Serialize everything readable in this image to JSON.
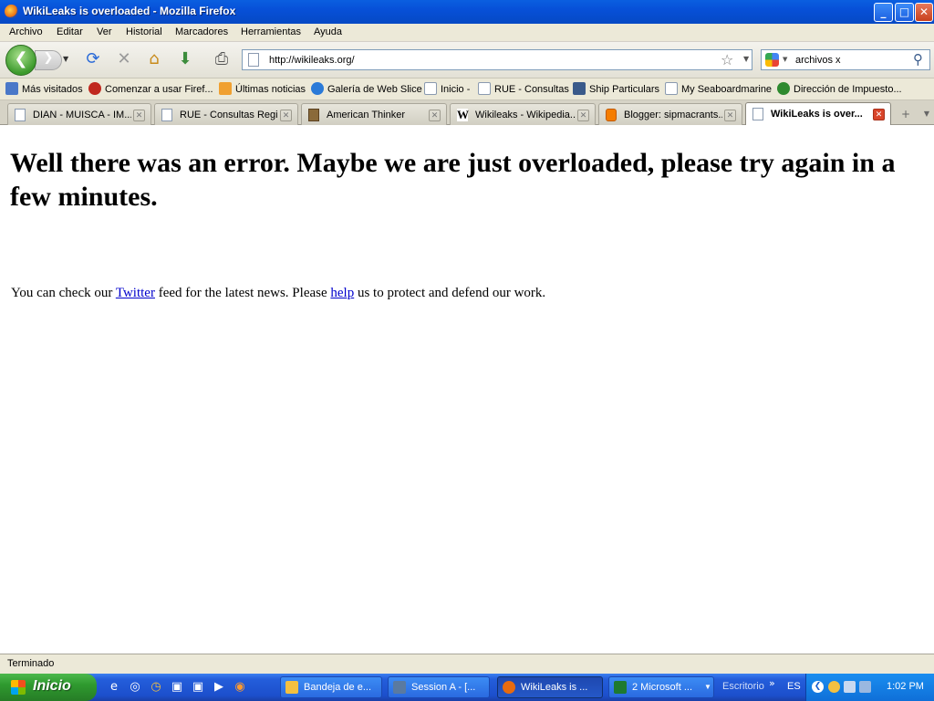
{
  "window": {
    "title": "WikiLeaks is overloaded - Mozilla Firefox",
    "controls": {
      "minimize": "_",
      "maximize": "□",
      "close": "✕"
    }
  },
  "menu": [
    "Archivo",
    "Editar",
    "Ver",
    "Historial",
    "Marcadores",
    "Herramientas",
    "Ayuda"
  ],
  "navigation": {
    "back_glyph": "❮",
    "forward_glyph": "❯",
    "url": "http://wikileaks.org/",
    "search_value": "archivos x",
    "icons": [
      "reload-icon",
      "stop-icon",
      "home-icon",
      "download-icon",
      "print-icon"
    ]
  },
  "bookmarks": [
    {
      "label": "Más visitados",
      "icon": "bookmark-folder-icon",
      "color": "#4a78c8"
    },
    {
      "label": "Comenzar a usar Firef...",
      "icon": "firefox-devil-icon",
      "color": "#c0281e"
    },
    {
      "label": "Últimas noticias",
      "icon": "rss-icon",
      "color": "#f0a030"
    },
    {
      "label": "Galería de Web Slice",
      "icon": "ie-icon",
      "color": "#2a7ad8"
    },
    {
      "label": "Inicio -",
      "icon": "page-icon",
      "color": "#ffffff"
    },
    {
      "label": "RUE - Consultas",
      "icon": "page-icon",
      "color": "#ffffff"
    },
    {
      "label": "Ship Particulars",
      "icon": "ship-icon",
      "color": "#3a5a8a"
    },
    {
      "label": "My Seaboardmarine",
      "icon": "page-icon",
      "color": "#ffffff"
    },
    {
      "label": "Dirección de Impuesto...",
      "icon": "dian-icon",
      "color": "#2e8a2e"
    }
  ],
  "tabs": [
    {
      "label": "DIAN - MUISCA - IM...",
      "active": false
    },
    {
      "label": "RUE - Consultas Regi...",
      "active": false
    },
    {
      "label": "American Thinker",
      "active": false
    },
    {
      "label": "Wikileaks - Wikipedia...",
      "active": false
    },
    {
      "label": "Blogger: sipmacrants...",
      "active": false
    },
    {
      "label": "WikiLeaks is over...",
      "active": true
    }
  ],
  "content": {
    "heading": "Well there was an error. Maybe we are just overloaded, please try again in a few minutes.",
    "p_before": "You can check our ",
    "link_twitter": "Twitter",
    "p_middle": " feed for the latest news. Please ",
    "link_help": "help",
    "p_after": " us to protect and defend our work."
  },
  "status": "Terminado",
  "taskbar": {
    "start": "Inicio",
    "buttons": [
      {
        "label": "Bandeja de e...",
        "color": "#f4c040"
      },
      {
        "label": "Session A - [...",
        "color": "#5a7aa0"
      },
      {
        "label": "WikiLeaks is ...",
        "color": "#e86b10",
        "active": true
      },
      {
        "label": "2 Microsoft ...",
        "color": "#1e7a30"
      }
    ],
    "desktop_label": "Escritorio",
    "lang": "ES",
    "clock": "1:02 PM"
  },
  "colors": {
    "accent": "#0a5fe0",
    "link": "#0000cc",
    "taskbar": "#245edb",
    "start": "#2f9a2f"
  }
}
